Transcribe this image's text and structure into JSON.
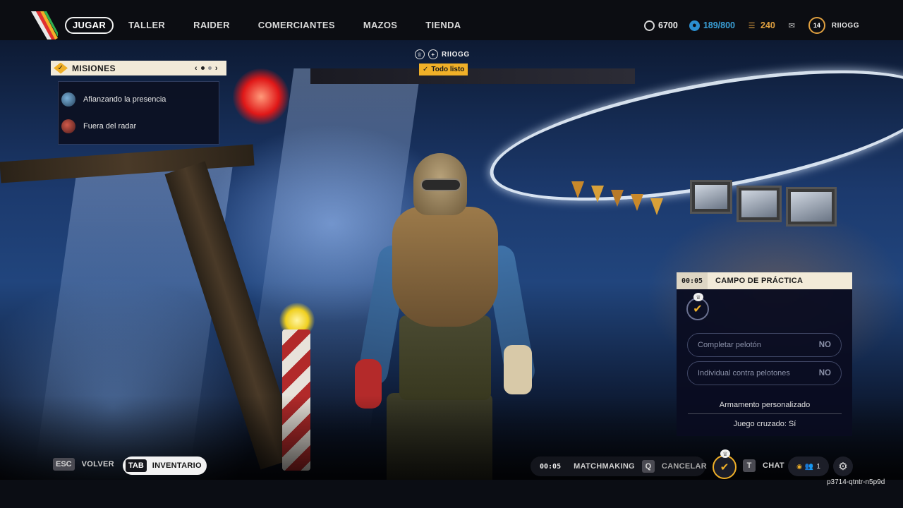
{
  "nav": {
    "items": [
      {
        "label": "JUGAR",
        "active": true
      },
      {
        "label": "TALLER",
        "active": false
      },
      {
        "label": "RAIDER",
        "active": false
      },
      {
        "label": "COMERCIANTES",
        "active": false
      },
      {
        "label": "MAZOS",
        "active": false
      },
      {
        "label": "TIENDA",
        "active": false
      }
    ]
  },
  "currencies": {
    "coins": "6700",
    "coins_icon": "coin-icon",
    "battlepass": "189/800",
    "battlepass_icon": "battlepass-icon",
    "battlepass_color": "#3aa0d8",
    "gold": "240",
    "gold_icon": "gold-bars-icon",
    "gold_color": "#e0a040",
    "mail_icon": "mail-icon",
    "level": "14",
    "username": "RIIOGG"
  },
  "missions": {
    "title": "MISIONES",
    "page": 1,
    "page_count": 2,
    "items": [
      {
        "label": "Afianzando la presencia",
        "icon": "mission-avatar-blue"
      },
      {
        "label": "Fuera del radar",
        "icon": "mission-avatar-red"
      }
    ]
  },
  "player": {
    "name": "RIIOGG",
    "status": "Todo listo"
  },
  "practice": {
    "timer": "00:05",
    "mode": "CAMPO DE PRÁCTICA",
    "options": [
      {
        "label": "Completar pelotón",
        "value": "NO"
      },
      {
        "label": "Individual contra pelotones",
        "value": "NO"
      }
    ],
    "loadout": "Armamento personalizado",
    "crossplay": "Juego cruzado: Sí"
  },
  "bottom": {
    "back_key": "ESC",
    "back_label": "VOLVER",
    "inventory_key": "TAB",
    "inventory_label": "INVENTARIO",
    "matchmaking_timer": "00:05",
    "matchmaking_label": "MATCHMAKING",
    "cancel_key": "Q",
    "cancel_label": "CANCELAR",
    "chat_key": "T",
    "chat_label": "CHAT",
    "party_count": "1"
  },
  "session_id": "p3714-qtntr-n5p9d",
  "colors": {
    "accent": "#f0b028",
    "panel_header": "#f2ead8",
    "panel_bg": "#0a0c20"
  }
}
